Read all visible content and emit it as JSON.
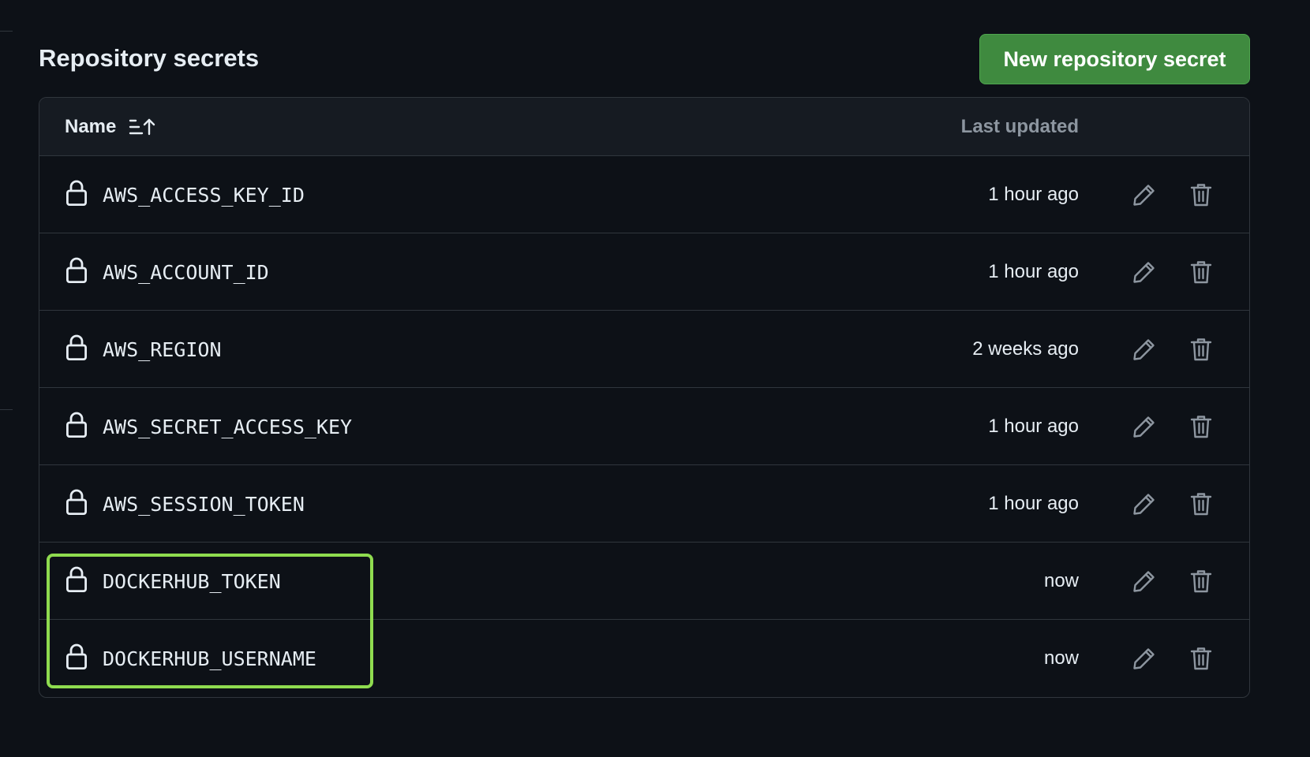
{
  "header": {
    "title": "Repository secrets",
    "new_button_label": "New repository secret"
  },
  "table": {
    "columns": {
      "name": "Name",
      "last_updated": "Last updated"
    },
    "rows": [
      {
        "name": "AWS_ACCESS_KEY_ID",
        "updated": "1 hour ago"
      },
      {
        "name": "AWS_ACCOUNT_ID",
        "updated": "1 hour ago"
      },
      {
        "name": "AWS_REGION",
        "updated": "2 weeks ago"
      },
      {
        "name": "AWS_SECRET_ACCESS_KEY",
        "updated": "1 hour ago"
      },
      {
        "name": "AWS_SESSION_TOKEN",
        "updated": "1 hour ago"
      },
      {
        "name": "DOCKERHUB_TOKEN",
        "updated": "now"
      },
      {
        "name": "DOCKERHUB_USERNAME",
        "updated": "now"
      }
    ]
  },
  "icons": {
    "row_icon": "lock-icon",
    "edit": "pencil-icon",
    "delete": "trash-icon",
    "sort": "sort-ascending-icon"
  },
  "colors": {
    "background": "#0d1117",
    "header_bg": "#161b22",
    "border": "#30363d",
    "primary_button": "#3f8a3f",
    "highlight": "#8fdc4f",
    "muted_text": "#8d96a0"
  }
}
